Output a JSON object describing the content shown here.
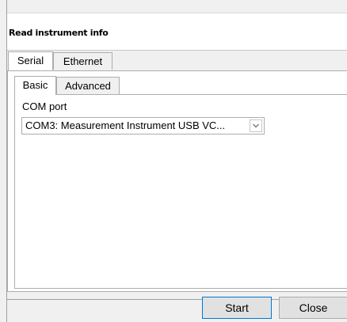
{
  "dialog": {
    "title": "Read instrument info"
  },
  "outer_tabs": [
    {
      "label": "Serial",
      "active": true
    },
    {
      "label": "Ethernet",
      "active": false
    }
  ],
  "inner_tabs": [
    {
      "label": "Basic",
      "active": true
    },
    {
      "label": "Advanced",
      "active": false
    }
  ],
  "com_port": {
    "label": "COM port",
    "selected": "COM3: Measurement Instrument USB VC..."
  },
  "buttons": {
    "start": "Start",
    "close": "Close"
  },
  "colors": {
    "background": "#f0f0f0",
    "panel": "#ffffff",
    "border": "#adadad",
    "button": "#e1e1e1",
    "focus_border": "#0078d7"
  },
  "icons": {
    "dropdown_arrow": "chevron-down-icon"
  }
}
